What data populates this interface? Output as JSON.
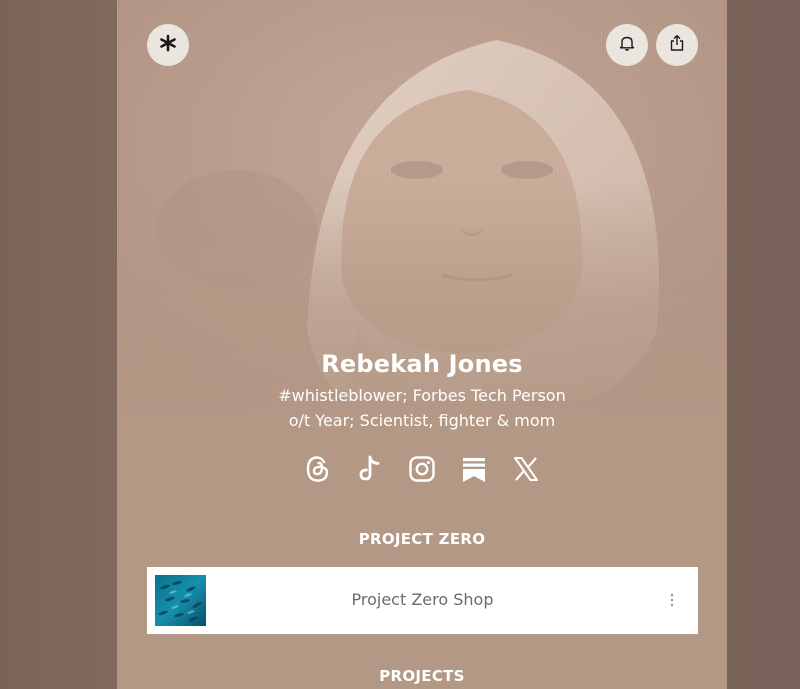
{
  "profile": {
    "name": "Rebekah Jones",
    "bio_line_1": "#whistleblower; Forbes Tech Person",
    "bio_line_2": "o/t Year; Scientist, fighter & mom"
  },
  "header": {
    "menu_icon": "linktree-asterisk-icon",
    "notify_icon": "bell-icon",
    "share_icon": "share-icon"
  },
  "social_links": [
    {
      "icon": "threads-icon"
    },
    {
      "icon": "tiktok-icon"
    },
    {
      "icon": "instagram-icon"
    },
    {
      "icon": "substack-icon"
    },
    {
      "icon": "x-icon"
    }
  ],
  "sections": [
    {
      "title": "PROJECT ZERO",
      "links": [
        {
          "label": "Project Zero Shop",
          "thumb": "fish-school-thumbnail",
          "more_icon": "kebab-menu-icon"
        }
      ]
    },
    {
      "title": "PROJECTS",
      "links": []
    }
  ],
  "colors": {
    "page_bg": "#7d6559",
    "card_bg": "#b49886",
    "button_bg": "#ebe5e0",
    "text": "#ffffff",
    "link_text": "#6b6b6b"
  }
}
